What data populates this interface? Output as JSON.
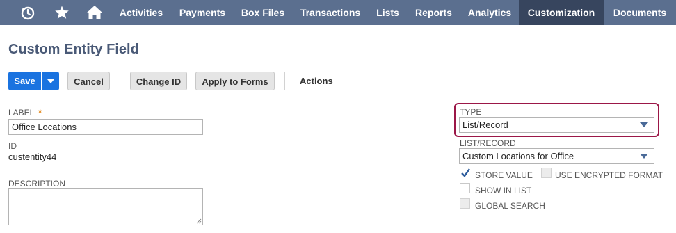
{
  "nav": {
    "items": [
      {
        "label": "Activities"
      },
      {
        "label": "Payments"
      },
      {
        "label": "Box Files"
      },
      {
        "label": "Transactions"
      },
      {
        "label": "Lists"
      },
      {
        "label": "Reports"
      },
      {
        "label": "Analytics"
      },
      {
        "label": "Customization"
      },
      {
        "label": "Documents"
      }
    ],
    "active": "Customization",
    "icons": [
      "recent-icon",
      "star-icon",
      "home-icon"
    ]
  },
  "page": {
    "title": "Custom Entity Field"
  },
  "toolbar": {
    "save_label": "Save",
    "cancel_label": "Cancel",
    "change_id_label": "Change ID",
    "apply_to_forms_label": "Apply to Forms",
    "actions_label": "Actions"
  },
  "form": {
    "label_label": "LABEL",
    "required_marker": "*",
    "label_value": "Office Locations",
    "id_label": "ID",
    "id_value": "custentity44",
    "description_label": "DESCRIPTION",
    "description_value": "",
    "type_label": "TYPE",
    "type_value": "List/Record",
    "list_record_label": "LIST/RECORD",
    "list_record_value": "Custom Locations for Office",
    "store_value_label": "STORE VALUE",
    "use_encrypted_format_label": "USE ENCRYPTED FORMAT",
    "show_in_list_label": "SHOW IN LIST",
    "global_search_label": "GLOBAL SEARCH"
  },
  "checkboxes": {
    "store_value": true,
    "use_encrypted_format": false,
    "show_in_list": false,
    "global_search": false
  },
  "colors": {
    "nav_bg": "#5b6f8f",
    "nav_active": "#37455e",
    "title": "#4a5a77",
    "primary_button": "#1a73e0",
    "highlight_border": "#9b1747",
    "required_star": "#e07b00"
  }
}
